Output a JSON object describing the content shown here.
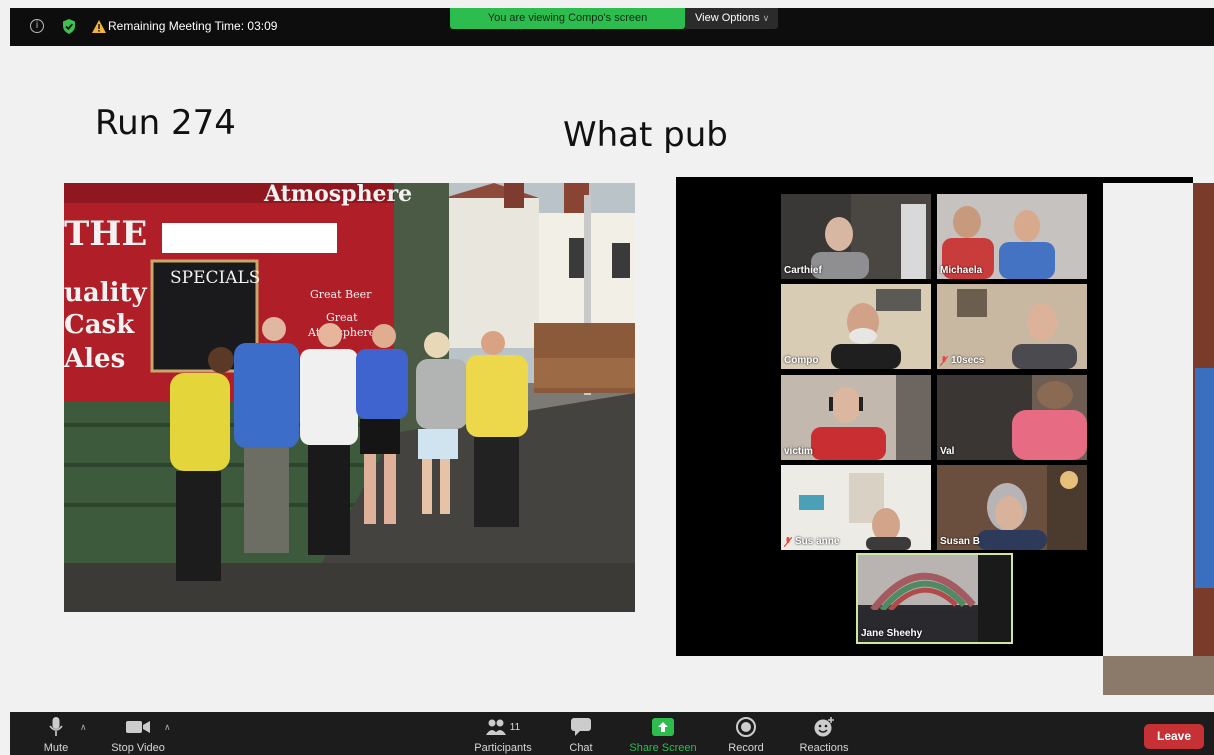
{
  "top_bar": {
    "remaining_label": "Remaining Meeting Time: 03:09",
    "viewing_label": "You are viewing Compo's screen",
    "view_options_label": "View Options",
    "icons": [
      "info-icon",
      "shield-icon",
      "warning-icon"
    ]
  },
  "slide": {
    "left_title": "Run 274",
    "right_title": "What pub",
    "sign_text": {
      "line1": "THE",
      "line2": "uality",
      "line3": "Cask",
      "line4": "Ales",
      "specials": "SPECIALS",
      "great_beer": "Great Beer",
      "great": "Great",
      "atmosphere": "Atmosphere",
      "banner": "Atmosphere"
    }
  },
  "gallery": {
    "participants": [
      {
        "name": "Carthief",
        "muted": false
      },
      {
        "name": "Michaela",
        "muted": false
      },
      {
        "name": "Compo",
        "muted": false
      },
      {
        "name": "10secs",
        "muted": true
      },
      {
        "name": "victim",
        "muted": false
      },
      {
        "name": "Val",
        "muted": false
      },
      {
        "name": "Sus anne",
        "muted": true
      },
      {
        "name": "Susan B",
        "muted": false
      },
      {
        "name": "Jane Sheehy",
        "muted": false
      }
    ]
  },
  "toolbar": {
    "mute": "Mute",
    "stop_video": "Stop Video",
    "participants": "Participants",
    "participants_count": "11",
    "chat": "Chat",
    "share_screen": "Share Screen",
    "record": "Record",
    "reactions": "Reactions",
    "leave": "Leave"
  },
  "colors": {
    "share_green": "#2dbd4e",
    "leave_red": "#c53135",
    "toolbar_bg": "#1c1c1c",
    "active_speaker_border": "#cfe6a6"
  }
}
